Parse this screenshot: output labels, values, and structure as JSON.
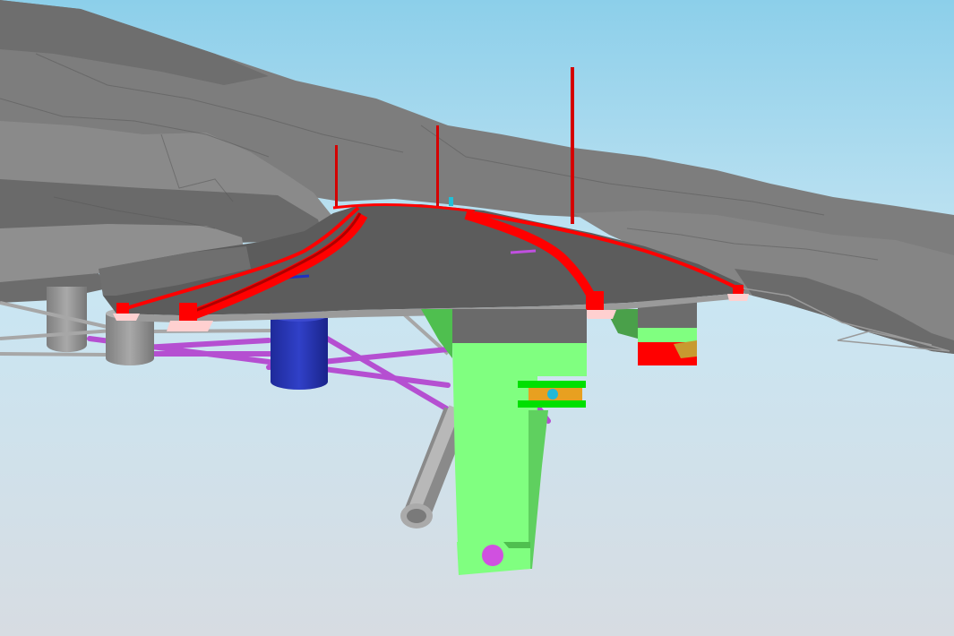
{
  "scene": {
    "kind": "3d-bim-viewport",
    "colors": {
      "sky_top": "#8ccfea",
      "sky_bottom": "#dde3ea",
      "terrain": "#7b7b7b",
      "terrain_dark": "#5f5f5f",
      "deck": "#5a5a5a",
      "barrier": "#ff0000",
      "pier": "#80ff80",
      "pier_dark": "#4fbf4f",
      "tank": "#2a35b8",
      "pipe": "#b54fd1",
      "grey_pipe": "#9a9a9a",
      "bearing": "#ffd0d0",
      "accent_orange": "#e8a020",
      "accent_cyan": "#20c0d8",
      "accent_magenta": "#d050e0"
    }
  }
}
